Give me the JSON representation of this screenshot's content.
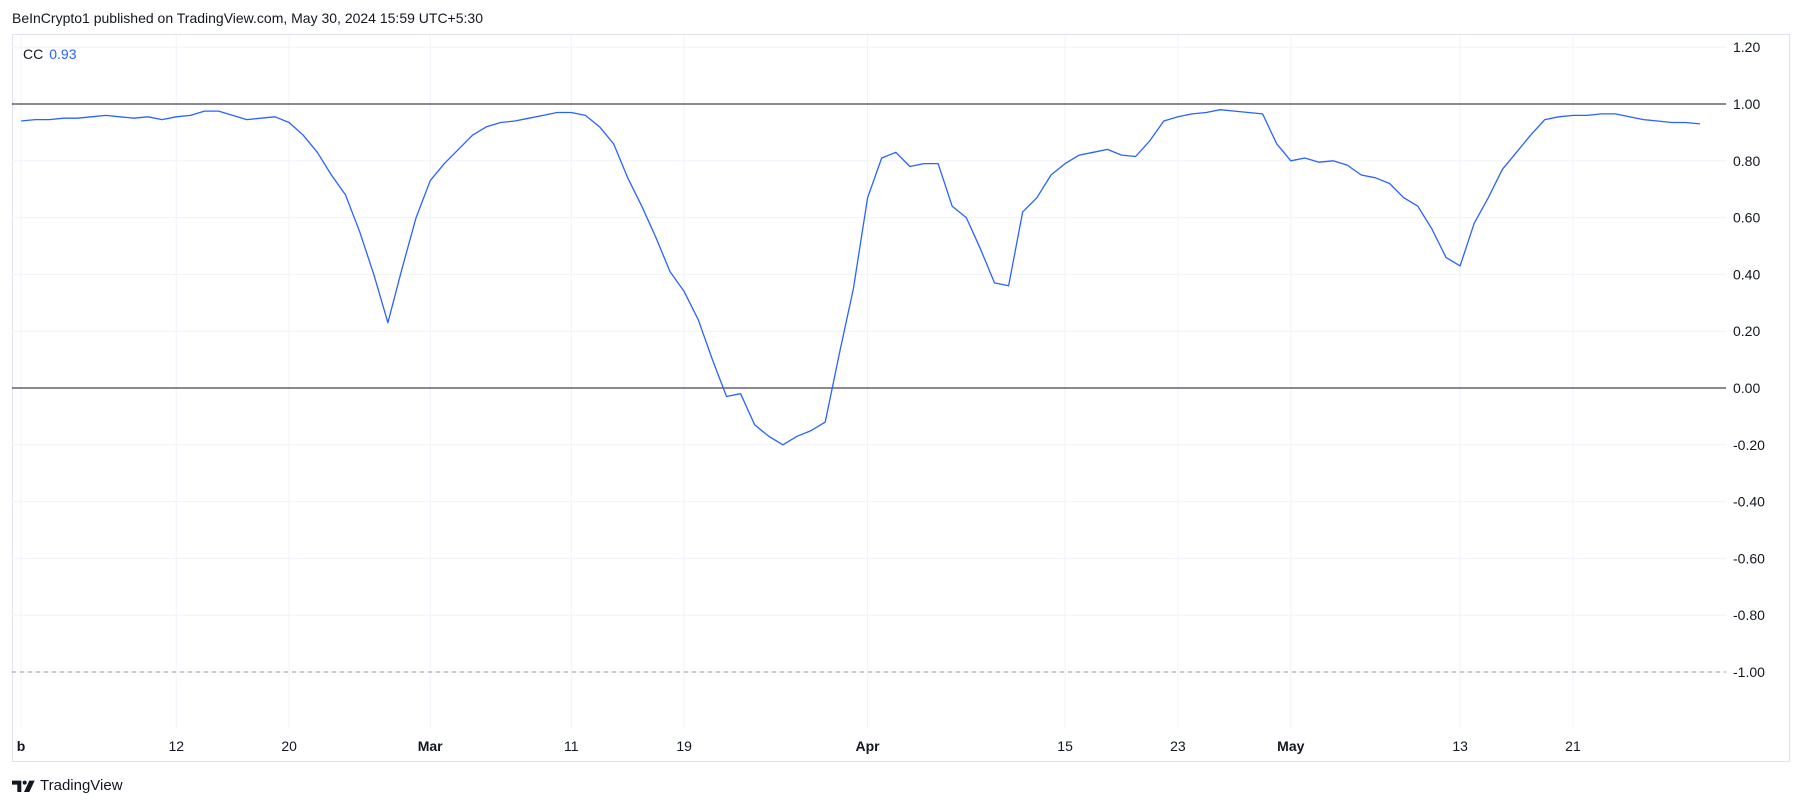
{
  "header": {
    "published_text": "BeInCrypto1 published on TradingView.com, May 30, 2024 15:59 UTC+5:30"
  },
  "legend": {
    "name": "CC",
    "value": "0.93"
  },
  "footer": {
    "brand": "TradingView",
    "logo_icon": "tradingview-logo-icon"
  },
  "colors": {
    "series": "#2962ff",
    "reference_line": "#131722",
    "dashed_line": "#9598a1",
    "grid": "#f0f3fa",
    "text": "#131722"
  },
  "chart_data": {
    "type": "line",
    "title": "",
    "xlabel": "",
    "ylabel": "",
    "ylim": [
      -1.2,
      1.2
    ],
    "grid": true,
    "y_ticks": [
      "1.20",
      "1.00",
      "0.80",
      "0.60",
      "0.40",
      "0.20",
      "0.00",
      "-0.20",
      "-0.40",
      "-0.60",
      "-0.80",
      "-1.00"
    ],
    "x_ticks": [
      {
        "label": "b",
        "bold": true,
        "date": "2024-02-01"
      },
      {
        "label": "12",
        "bold": false,
        "date": "2024-02-12"
      },
      {
        "label": "20",
        "bold": false,
        "date": "2024-02-20"
      },
      {
        "label": "Mar",
        "bold": true,
        "date": "2024-03-01"
      },
      {
        "label": "11",
        "bold": false,
        "date": "2024-03-11"
      },
      {
        "label": "19",
        "bold": false,
        "date": "2024-03-19"
      },
      {
        "label": "Apr",
        "bold": true,
        "date": "2024-04-01"
      },
      {
        "label": "15",
        "bold": false,
        "date": "2024-04-15"
      },
      {
        "label": "23",
        "bold": false,
        "date": "2024-04-23"
      },
      {
        "label": "May",
        "bold": true,
        "date": "2024-05-01"
      },
      {
        "label": "13",
        "bold": false,
        "date": "2024-05-13"
      },
      {
        "label": "21",
        "bold": false,
        "date": "2024-05-21"
      }
    ],
    "reference_lines": [
      {
        "y": 1.0,
        "style": "solid"
      },
      {
        "y": 0.0,
        "style": "solid"
      },
      {
        "y": -1.0,
        "style": "dashed"
      }
    ],
    "series": [
      {
        "name": "CC",
        "x": [
          "2024-02-01",
          "2024-02-02",
          "2024-02-03",
          "2024-02-04",
          "2024-02-05",
          "2024-02-06",
          "2024-02-07",
          "2024-02-08",
          "2024-02-09",
          "2024-02-10",
          "2024-02-11",
          "2024-02-12",
          "2024-02-13",
          "2024-02-14",
          "2024-02-15",
          "2024-02-16",
          "2024-02-17",
          "2024-02-18",
          "2024-02-19",
          "2024-02-20",
          "2024-02-21",
          "2024-02-22",
          "2024-02-23",
          "2024-02-24",
          "2024-02-25",
          "2024-02-26",
          "2024-02-27",
          "2024-02-28",
          "2024-02-29",
          "2024-03-01",
          "2024-03-02",
          "2024-03-03",
          "2024-03-04",
          "2024-03-05",
          "2024-03-06",
          "2024-03-07",
          "2024-03-08",
          "2024-03-09",
          "2024-03-10",
          "2024-03-11",
          "2024-03-12",
          "2024-03-13",
          "2024-03-14",
          "2024-03-15",
          "2024-03-16",
          "2024-03-17",
          "2024-03-18",
          "2024-03-19",
          "2024-03-20",
          "2024-03-21",
          "2024-03-22",
          "2024-03-23",
          "2024-03-24",
          "2024-03-25",
          "2024-03-26",
          "2024-03-27",
          "2024-03-28",
          "2024-03-29",
          "2024-03-30",
          "2024-03-31",
          "2024-04-01",
          "2024-04-02",
          "2024-04-03",
          "2024-04-04",
          "2024-04-05",
          "2024-04-06",
          "2024-04-07",
          "2024-04-08",
          "2024-04-09",
          "2024-04-10",
          "2024-04-11",
          "2024-04-12",
          "2024-04-13",
          "2024-04-14",
          "2024-04-15",
          "2024-04-16",
          "2024-04-17",
          "2024-04-18",
          "2024-04-19",
          "2024-04-20",
          "2024-04-21",
          "2024-04-22",
          "2024-04-23",
          "2024-04-24",
          "2024-04-25",
          "2024-04-26",
          "2024-04-27",
          "2024-04-28",
          "2024-04-29",
          "2024-04-30",
          "2024-05-01",
          "2024-05-02",
          "2024-05-03",
          "2024-05-04",
          "2024-05-05",
          "2024-05-06",
          "2024-05-07",
          "2024-05-08",
          "2024-05-09",
          "2024-05-10",
          "2024-05-11",
          "2024-05-12",
          "2024-05-13",
          "2024-05-14",
          "2024-05-15",
          "2024-05-16",
          "2024-05-17",
          "2024-05-18",
          "2024-05-19",
          "2024-05-20",
          "2024-05-21",
          "2024-05-22",
          "2024-05-23",
          "2024-05-24",
          "2024-05-25",
          "2024-05-26",
          "2024-05-27",
          "2024-05-28",
          "2024-05-29",
          "2024-05-30"
        ],
        "y": [
          0.94,
          0.945,
          0.945,
          0.95,
          0.95,
          0.955,
          0.96,
          0.955,
          0.95,
          0.955,
          0.945,
          0.955,
          0.96,
          0.975,
          0.975,
          0.96,
          0.945,
          0.95,
          0.955,
          0.935,
          0.89,
          0.83,
          0.75,
          0.68,
          0.55,
          0.4,
          0.23,
          0.42,
          0.6,
          0.73,
          0.79,
          0.84,
          0.89,
          0.92,
          0.935,
          0.94,
          0.95,
          0.96,
          0.97,
          0.97,
          0.96,
          0.92,
          0.86,
          0.74,
          0.64,
          0.53,
          0.41,
          0.34,
          0.24,
          0.1,
          -0.03,
          -0.02,
          -0.13,
          -0.17,
          -0.2,
          -0.17,
          -0.15,
          -0.12,
          0.12,
          0.35,
          0.67,
          0.81,
          0.83,
          0.78,
          0.79,
          0.79,
          0.64,
          0.6,
          0.49,
          0.37,
          0.36,
          0.62,
          0.67,
          0.75,
          0.79,
          0.82,
          0.83,
          0.84,
          0.82,
          0.815,
          0.87,
          0.94,
          0.955,
          0.965,
          0.97,
          0.98,
          0.975,
          0.97,
          0.965,
          0.86,
          0.8,
          0.81,
          0.795,
          0.8,
          0.785,
          0.75,
          0.74,
          0.72,
          0.67,
          0.64,
          0.56,
          0.46,
          0.43,
          0.58,
          0.67,
          0.77,
          0.83,
          0.89,
          0.945,
          0.955,
          0.96,
          0.96,
          0.965,
          0.965,
          0.955,
          0.945,
          0.94,
          0.935,
          0.935,
          0.93
        ]
      }
    ]
  }
}
